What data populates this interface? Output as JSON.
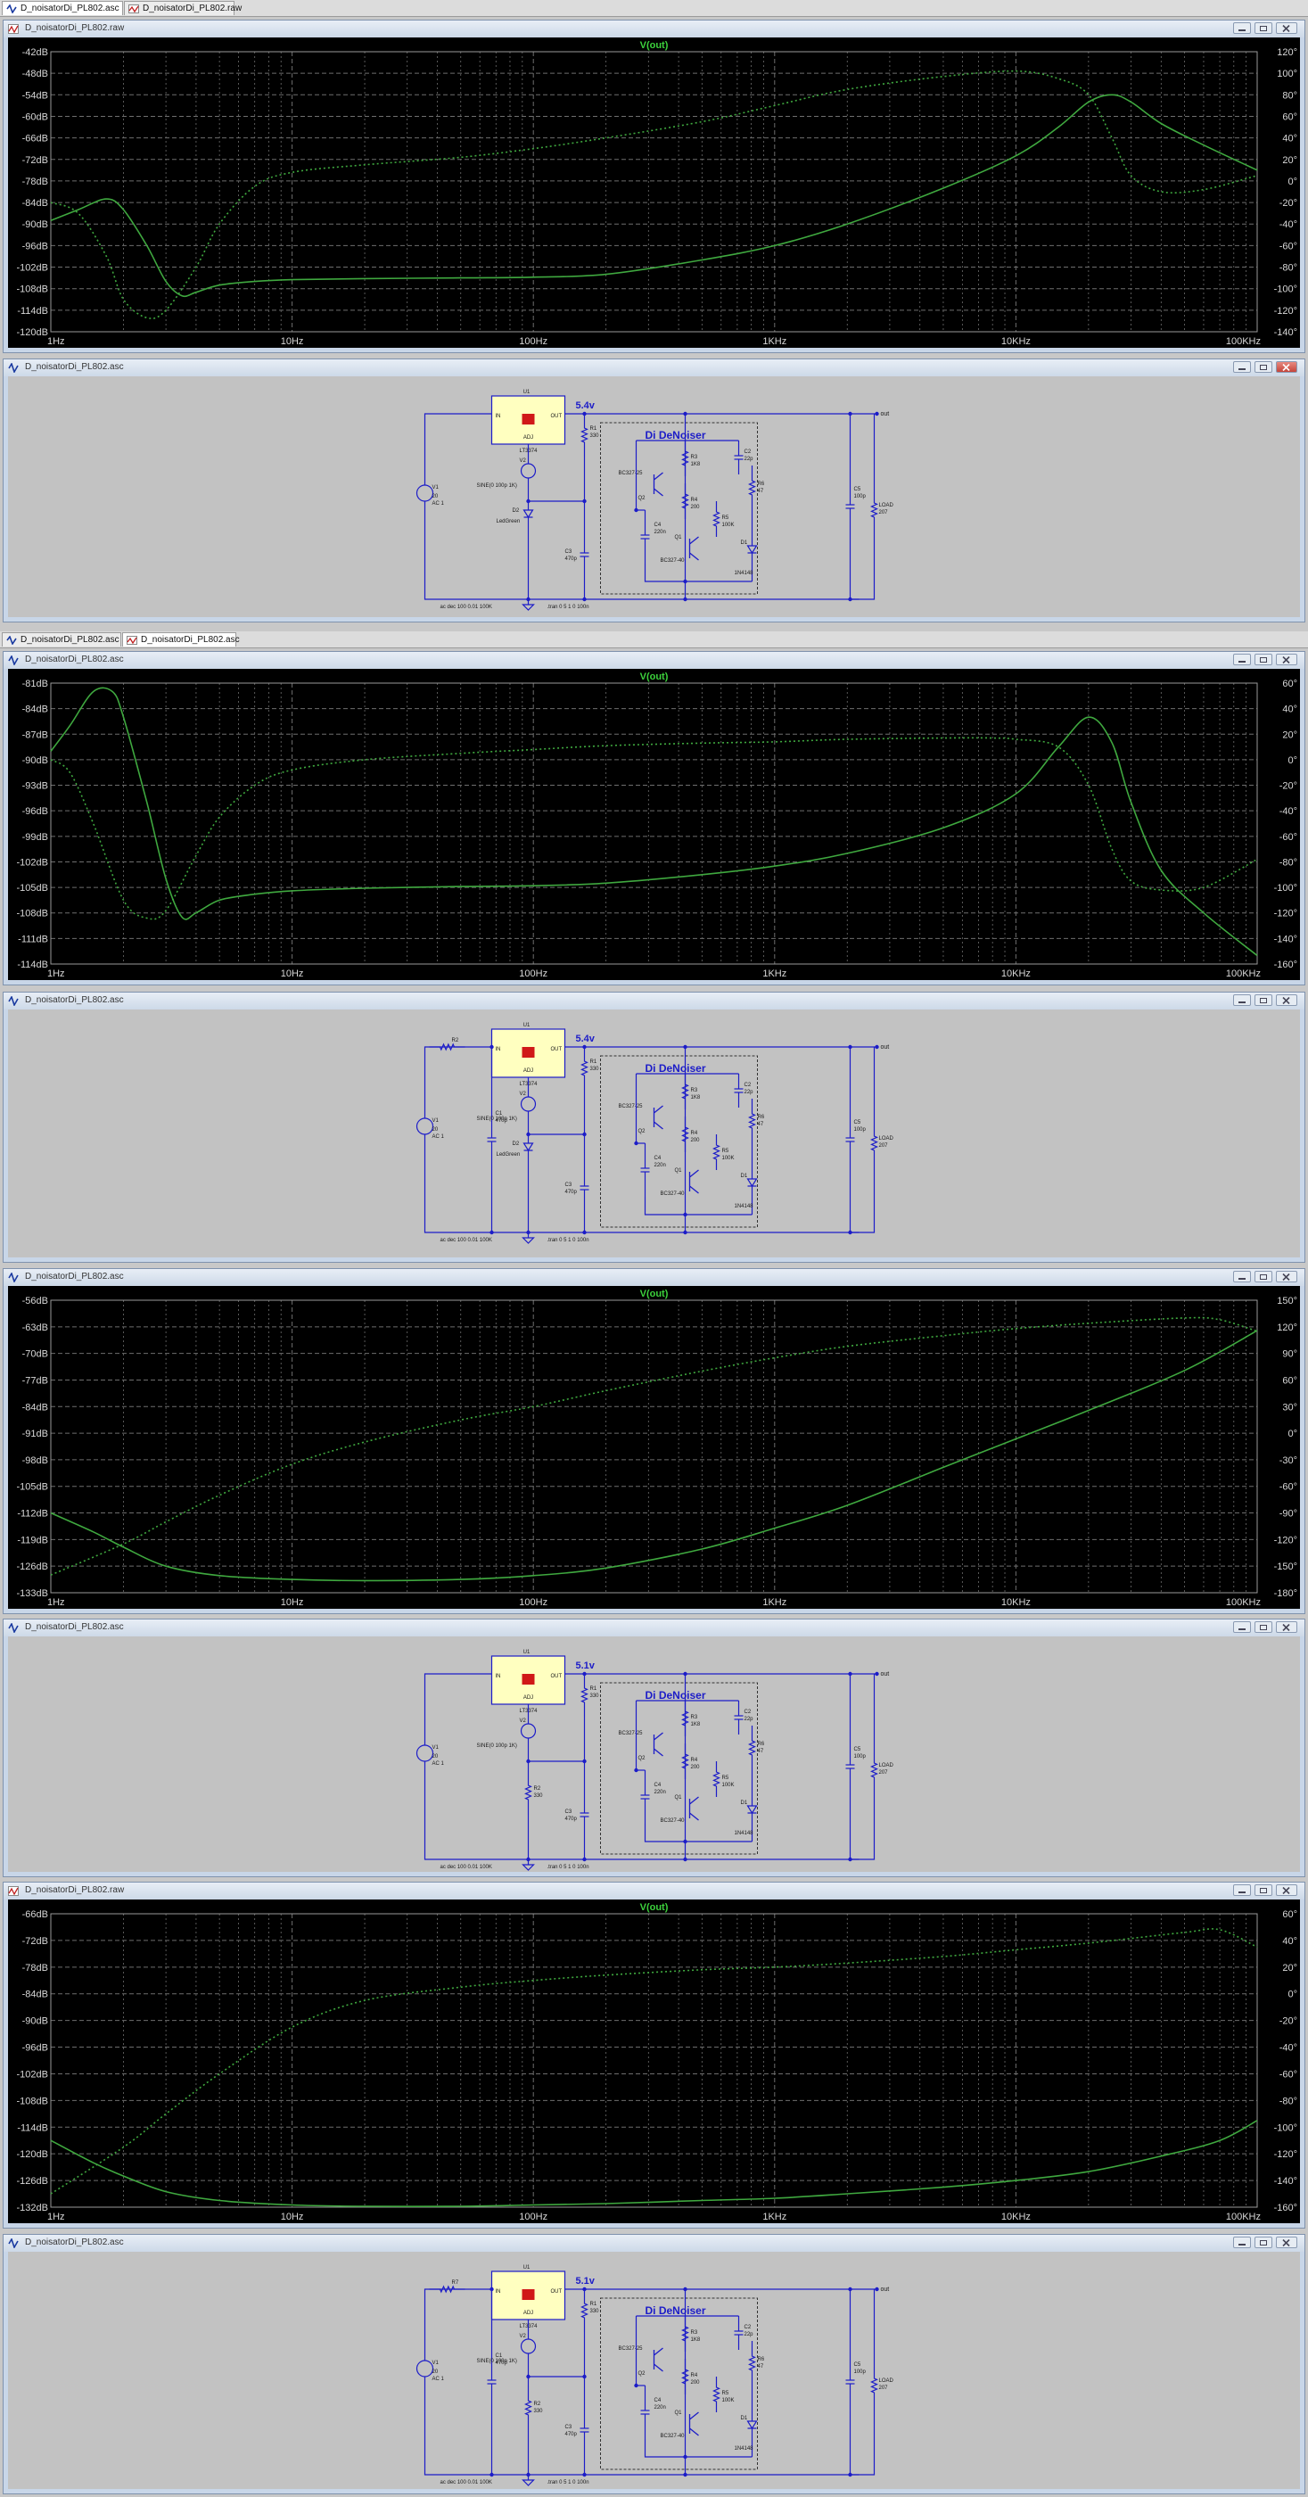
{
  "tabs_top": [
    {
      "label": "D_noisatorDi_PL802.asc",
      "icon": "schematic-icon",
      "active": true
    },
    {
      "label": "D_noisatorDi_PL802.raw",
      "icon": "waveform-icon",
      "active": false
    }
  ],
  "tabs_mid": [
    {
      "label": "D_noisatorDi_PL802.asc",
      "icon": "schematic-icon",
      "active": false
    },
    {
      "label": "D_noisatorDi_PL802.asc",
      "icon": "schematic-icon",
      "active": true
    }
  ],
  "windows": {
    "plot1": {
      "title": "D_noisatorDi_PL802.raw"
    },
    "sch1": {
      "title": "D_noisatorDi_PL802.asc"
    },
    "plot2": {
      "title": "D_noisatorDi_PL802.asc"
    },
    "sch2": {
      "title": "D_noisatorDi_PL802.asc"
    },
    "plot3": {
      "title": "D_noisatorDi_PL802.asc"
    },
    "sch3": {
      "title": "D_noisatorDi_PL802.asc"
    },
    "plot4": {
      "title": "D_noisatorDi_PL802.raw"
    },
    "sch4": {
      "title": "D_noisatorDi_PL802.asc"
    }
  },
  "colors": {
    "trace": "#3fa83f",
    "trace_label": "#3cd23c",
    "grid": "#6e6e6e",
    "wire": "#1c1cc8",
    "ic_fill": "#ffffc0",
    "ic_logo": "#d01818",
    "plot_bg": "#000000",
    "schematic_bg": "#c2c2c2"
  },
  "chart_data": [
    {
      "type": "line",
      "title": "V(out)",
      "x_scale": "log",
      "xlim": [
        1,
        100000
      ],
      "x_ticks": [
        "1Hz",
        "10Hz",
        "100Hz",
        "1KHz",
        "10KHz",
        "100KHz"
      ],
      "ylim": [
        -120,
        -42
      ],
      "y_ticks": [
        "-42dB",
        "-48dB",
        "-54dB",
        "-60dB",
        "-66dB",
        "-72dB",
        "-78dB",
        "-84dB",
        "-90dB",
        "-96dB",
        "-102dB",
        "-108dB",
        "-114dB",
        "-120dB"
      ],
      "y2lim": [
        -140,
        120
      ],
      "y2_ticks": [
        "120°",
        "100°",
        "80°",
        "60°",
        "40°",
        "20°",
        "0°",
        "-20°",
        "-40°",
        "-60°",
        "-80°",
        "-100°",
        "-120°",
        "-140°"
      ],
      "grid": true,
      "series": [
        {
          "style": "solid",
          "axis": "left",
          "x": [
            1,
            1.3,
            1.7,
            2,
            2.5,
            3,
            3.5,
            4,
            5,
            7,
            10,
            20,
            50,
            100,
            200,
            500,
            1000,
            2000,
            5000,
            10000,
            15000,
            20000,
            25000,
            30000,
            40000,
            60000,
            100000
          ],
          "y": [
            -89,
            -86,
            -83,
            -86,
            -96,
            -106,
            -110,
            -109,
            -107,
            -106,
            -105.5,
            -105.2,
            -105,
            -104.8,
            -104,
            -100,
            -96,
            -90,
            -80,
            -71,
            -63,
            -56,
            -54,
            -56,
            -62,
            -68,
            -75
          ]
        },
        {
          "style": "dotted",
          "axis": "right",
          "x": [
            1,
            1.3,
            1.7,
            2,
            2.5,
            3,
            4,
            5,
            7,
            10,
            20,
            50,
            100,
            200,
            500,
            1000,
            2000,
            5000,
            10000,
            15000,
            20000,
            25000,
            30000,
            40000,
            60000,
            100000
          ],
          "y": [
            -20,
            -30,
            -70,
            -110,
            -127,
            -120,
            -80,
            -40,
            -5,
            8,
            15,
            22,
            30,
            40,
            55,
            70,
            85,
            97,
            102,
            95,
            80,
            40,
            5,
            -10,
            -8,
            5
          ]
        }
      ]
    },
    {
      "type": "line",
      "title": "V(out)",
      "x_scale": "log",
      "xlim": [
        1,
        100000
      ],
      "x_ticks": [
        "1Hz",
        "10Hz",
        "100Hz",
        "1KHz",
        "10KHz",
        "100KHz"
      ],
      "ylim": [
        -114,
        -81
      ],
      "y_ticks": [
        "-81dB",
        "-84dB",
        "-87dB",
        "-90dB",
        "-93dB",
        "-96dB",
        "-99dB",
        "-102dB",
        "-105dB",
        "-108dB",
        "-111dB",
        "-114dB"
      ],
      "y2lim": [
        -160,
        60
      ],
      "y2_ticks": [
        "60°",
        "40°",
        "20°",
        "0°",
        "-20°",
        "-40°",
        "-60°",
        "-80°",
        "-100°",
        "-120°",
        "-140°",
        "-160°"
      ],
      "grid": true,
      "series": [
        {
          "style": "solid",
          "axis": "left",
          "x": [
            1,
            1.2,
            1.5,
            1.8,
            2,
            2.5,
            3,
            3.5,
            4,
            5,
            7,
            10,
            20,
            50,
            100,
            200,
            500,
            1000,
            2000,
            5000,
            10000,
            15000,
            20000,
            25000,
            30000,
            40000,
            60000,
            100000
          ],
          "y": [
            -89,
            -86,
            -82,
            -82,
            -85,
            -95,
            -104,
            -108.5,
            -108,
            -106.5,
            -105.8,
            -105.4,
            -105.1,
            -104.9,
            -104.8,
            -104.5,
            -103.5,
            -102.5,
            -101,
            -98,
            -94,
            -88.5,
            -85,
            -88,
            -95,
            -103,
            -108,
            -113
          ]
        },
        {
          "style": "dotted",
          "axis": "right",
          "x": [
            1,
            1.2,
            1.5,
            2,
            2.5,
            3,
            4,
            5,
            7,
            10,
            20,
            50,
            100,
            200,
            500,
            1000,
            2000,
            5000,
            8000,
            10000,
            15000,
            20000,
            25000,
            30000,
            40000,
            60000,
            100000
          ],
          "y": [
            0,
            -10,
            -50,
            -110,
            -124,
            -118,
            -75,
            -45,
            -20,
            -8,
            0,
            5,
            8,
            11,
            13,
            14,
            16,
            17,
            17,
            16,
            10,
            -20,
            -70,
            -95,
            -102,
            -100,
            -78
          ]
        }
      ]
    },
    {
      "type": "line",
      "title": "V(out)",
      "x_scale": "log",
      "xlim": [
        1,
        100000
      ],
      "x_ticks": [
        "1Hz",
        "10Hz",
        "100Hz",
        "1KHz",
        "10KHz",
        "100KHz"
      ],
      "ylim": [
        -133,
        -56
      ],
      "y_ticks": [
        "-56dB",
        "-63dB",
        "-70dB",
        "-77dB",
        "-84dB",
        "-91dB",
        "-98dB",
        "-105dB",
        "-112dB",
        "-119dB",
        "-126dB",
        "-133dB"
      ],
      "y2lim": [
        -180,
        150
      ],
      "y2_ticks": [
        "150°",
        "120°",
        "90°",
        "60°",
        "30°",
        "0°",
        "-30°",
        "-60°",
        "-90°",
        "-120°",
        "-150°",
        "-180°"
      ],
      "grid": true,
      "series": [
        {
          "style": "solid",
          "axis": "left",
          "x": [
            1,
            1.5,
            2,
            3,
            5,
            10,
            20,
            50,
            100,
            200,
            500,
            1000,
            2000,
            5000,
            10000,
            20000,
            50000,
            100000
          ],
          "y": [
            -112,
            -117,
            -121,
            -126,
            -128.5,
            -129.5,
            -129.8,
            -129.5,
            -128.5,
            -126.5,
            -121.5,
            -116,
            -110,
            -100,
            -92.5,
            -85,
            -74.5,
            -64
          ]
        },
        {
          "style": "dotted",
          "axis": "right",
          "x": [
            1,
            2,
            3,
            5,
            10,
            20,
            50,
            100,
            200,
            500,
            1000,
            2000,
            5000,
            10000,
            20000,
            50000,
            70000,
            100000
          ],
          "y": [
            -160,
            -125,
            -100,
            -70,
            -35,
            -10,
            15,
            30,
            48,
            70,
            85,
            98,
            110,
            118,
            124,
            130,
            128,
            115
          ]
        }
      ]
    },
    {
      "type": "line",
      "title": "V(out)",
      "x_scale": "log",
      "xlim": [
        1,
        100000
      ],
      "x_ticks": [
        "1Hz",
        "10Hz",
        "100Hz",
        "1KHz",
        "10KHz",
        "100KHz"
      ],
      "ylim": [
        -132,
        -66
      ],
      "y_ticks": [
        "-66dB",
        "-72dB",
        "-78dB",
        "-84dB",
        "-90dB",
        "-96dB",
        "-102dB",
        "-108dB",
        "-114dB",
        "-120dB",
        "-126dB",
        "-132dB"
      ],
      "y2lim": [
        -160,
        60
      ],
      "y2_ticks": [
        "60°",
        "40°",
        "20°",
        "0°",
        "-20°",
        "-40°",
        "-60°",
        "-80°",
        "-100°",
        "-120°",
        "-140°",
        "-160°"
      ],
      "grid": true,
      "series": [
        {
          "style": "solid",
          "axis": "left",
          "x": [
            1,
            1.5,
            2,
            3,
            5,
            10,
            20,
            50,
            100,
            200,
            500,
            1000,
            2000,
            5000,
            10000,
            20000,
            40000,
            70000,
            100000
          ],
          "y": [
            -117,
            -122,
            -125,
            -128.5,
            -130.5,
            -131.5,
            -131.8,
            -131.8,
            -131.5,
            -131.2,
            -130.5,
            -130,
            -129,
            -127.5,
            -126,
            -124,
            -120.5,
            -117,
            -112.5
          ]
        },
        {
          "style": "dotted",
          "axis": "right",
          "x": [
            1,
            2,
            3,
            5,
            10,
            20,
            50,
            100,
            200,
            500,
            1000,
            2000,
            5000,
            10000,
            20000,
            50000,
            70000,
            100000
          ],
          "y": [
            -150,
            -115,
            -90,
            -60,
            -25,
            -5,
            5,
            10,
            14,
            18,
            20,
            23,
            28,
            33,
            38,
            46,
            48,
            35
          ]
        }
      ]
    }
  ],
  "schematics": [
    {
      "ic_ref": "U1",
      "ic_in": "IN",
      "ic_out": "OUT",
      "ic_adj": "ADJ",
      "ic_part": "LT3374",
      "out_voltage": "5.4v",
      "out_label": "out",
      "block_title": "Di DeNoiser",
      "src_ref": "V1",
      "src_val1": "20",
      "src_val2": "AC 1",
      "sine_ref": "V2",
      "sine_val": "SINE(0 100p 1K)",
      "led_ref": "D2",
      "led_val": "LedGreen",
      "r_prev": "",
      "c_in_ref": "",
      "c_in_val": "",
      "r_lower_ref": "",
      "r_lower_val": "",
      "r1_ref": "R1",
      "r1_val": "330",
      "r3_ref": "R3",
      "r3_val": "1K8",
      "r4_ref": "R4",
      "r4_val": "200",
      "r5_ref": "R5",
      "r5_val": "100K",
      "r6_ref": "R6",
      "r6_val": "47",
      "q2_ref": "Q2",
      "q2_val": "BC327-25",
      "q1_ref": "Q1",
      "q1_val": "BC327-40",
      "c3_ref": "C3",
      "c3_val": "470p",
      "c4_ref": "C4",
      "c4_val": "220n",
      "c2_ref": "C2",
      "c2_val": "22p",
      "d1_ref": "D1",
      "d1_val": "1N4148",
      "c5_ref": "C5",
      "c5_val": "100p",
      "load_ref": "LOAD",
      "load_val": "207",
      "directive1": "ac dec 100 0.01 100K",
      "directive2": ".tran 0 5 1 0 100n"
    },
    {
      "ic_ref": "U1",
      "ic_in": "IN",
      "ic_out": "OUT",
      "ic_adj": "ADJ",
      "ic_part": "LT3374",
      "out_voltage": "5.4v",
      "out_label": "out",
      "block_title": "Di DeNoiser",
      "src_ref": "V1",
      "src_val1": "20",
      "src_val2": "AC 1",
      "sine_ref": "V2",
      "sine_val": "SINE(0 100p 1K)",
      "led_ref": "D2",
      "led_val": "LedGreen",
      "r_prev": "R2",
      "c_in_ref": "C1",
      "c_in_val": "470p",
      "r_lower_ref": "",
      "r_lower_val": "",
      "r1_ref": "R1",
      "r1_val": "330",
      "r3_ref": "R3",
      "r3_val": "1K8",
      "r4_ref": "R4",
      "r4_val": "200",
      "r5_ref": "R5",
      "r5_val": "100K",
      "r6_ref": "R6",
      "r6_val": "47",
      "q2_ref": "Q2",
      "q2_val": "BC327-25",
      "q1_ref": "Q1",
      "q1_val": "BC327-40",
      "c3_ref": "C3",
      "c3_val": "470p",
      "c4_ref": "C4",
      "c4_val": "220n",
      "c2_ref": "C2",
      "c2_val": "22p",
      "d1_ref": "D1",
      "d1_val": "1N4148",
      "c5_ref": "C5",
      "c5_val": "100p",
      "load_ref": "LOAD",
      "load_val": "207",
      "directive1": "ac dec 100 0.01 100K",
      "directive2": ".tran 0 5 1 0 100n"
    },
    {
      "ic_ref": "U1",
      "ic_in": "IN",
      "ic_out": "OUT",
      "ic_adj": "ADJ",
      "ic_part": "LT3374",
      "out_voltage": "5.1v",
      "out_label": "out",
      "block_title": "Di DeNoiser",
      "src_ref": "V1",
      "src_val1": "20",
      "src_val2": "AC 1",
      "sine_ref": "V2",
      "sine_val": "SINE(0 100p 1K)",
      "led_ref": "",
      "led_val": "",
      "r_prev": "",
      "c_in_ref": "",
      "c_in_val": "",
      "r_lower_ref": "R2",
      "r_lower_val": "330",
      "r1_ref": "R1",
      "r1_val": "330",
      "r3_ref": "R3",
      "r3_val": "1K8",
      "r4_ref": "R4",
      "r4_val": "200",
      "r5_ref": "R5",
      "r5_val": "100K",
      "r6_ref": "R6",
      "r6_val": "47",
      "q2_ref": "Q2",
      "q2_val": "BC327-25",
      "q1_ref": "Q1",
      "q1_val": "BC327-40",
      "c3_ref": "C3",
      "c3_val": "470p",
      "c4_ref": "C4",
      "c4_val": "220n",
      "c2_ref": "C2",
      "c2_val": "22p",
      "d1_ref": "D1",
      "d1_val": "1N4148",
      "c5_ref": "C5",
      "c5_val": "100p",
      "load_ref": "LOAD",
      "load_val": "207",
      "directive1": "ac dec 100 0.01 100K",
      "directive2": ".tran 0 5 1 0 100n"
    },
    {
      "ic_ref": "U1",
      "ic_in": "IN",
      "ic_out": "OUT",
      "ic_adj": "ADJ",
      "ic_part": "LT3374",
      "out_voltage": "5.1v",
      "out_label": "out",
      "block_title": "Di DeNoiser",
      "src_ref": "V1",
      "src_val1": "20",
      "src_val2": "AC 1",
      "sine_ref": "V2",
      "sine_val": "SINE(0 100p 1K)",
      "led_ref": "",
      "led_val": "",
      "r_prev": "R7",
      "c_in_ref": "C1",
      "c_in_val": "470p",
      "r_lower_ref": "R2",
      "r_lower_val": "330",
      "r1_ref": "R1",
      "r1_val": "330",
      "r3_ref": "R3",
      "r3_val": "1K8",
      "r4_ref": "R4",
      "r4_val": "200",
      "r5_ref": "R5",
      "r5_val": "100K",
      "r6_ref": "R6",
      "r6_val": "47",
      "q2_ref": "Q2",
      "q2_val": "BC327-25",
      "q1_ref": "Q1",
      "q1_val": "BC327-40",
      "c3_ref": "C3",
      "c3_val": "470p",
      "c4_ref": "C4",
      "c4_val": "220n",
      "c2_ref": "C2",
      "c2_val": "22p",
      "d1_ref": "D1",
      "d1_val": "1N4148",
      "c5_ref": "C5",
      "c5_val": "100p",
      "load_ref": "LOAD",
      "load_val": "207",
      "directive1": "ac dec 100 0.01 100K",
      "directive2": ".tran 0 5 1 0 100n"
    }
  ]
}
